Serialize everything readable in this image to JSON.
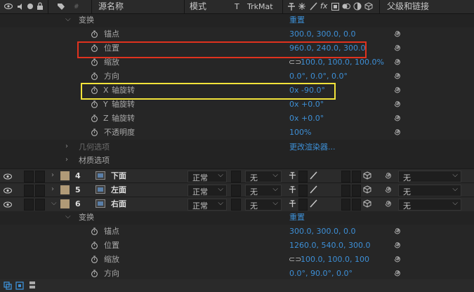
{
  "header": {
    "source_name": "源名称",
    "mode": "模式",
    "t": "T",
    "trkmat": "TrkMat",
    "parent": "父级和链接",
    "hash": "#"
  },
  "transform_group_1": {
    "label": "变换",
    "reset": "重置",
    "props": [
      {
        "name": "锚点",
        "value": "300.0, 300.0, 0.0",
        "axis": ""
      },
      {
        "name": "位置",
        "value": "960.0, 240.0, 300.0",
        "axis": ""
      },
      {
        "name": "缩放",
        "value": "100.0, 100.0, 100.0%",
        "axis": ""
      },
      {
        "name": "方向",
        "value": "0.0°, 0.0°, 0.0°",
        "axis": ""
      },
      {
        "name": "轴旋转",
        "value": "0x -90.0°",
        "axis": "X"
      },
      {
        "name": "轴旋转",
        "value": "0x +0.0°",
        "axis": "Y"
      },
      {
        "name": "轴旋转",
        "value": "0x +0.0°",
        "axis": "Z"
      },
      {
        "name": "不透明度",
        "value": "100%",
        "axis": ""
      }
    ]
  },
  "geometry": {
    "label": "几何选项",
    "value": "更改渲染器..."
  },
  "material": {
    "label": "材质选项"
  },
  "layers": [
    {
      "num": "4",
      "name": "下面",
      "mode": "正常",
      "trkmat": "无",
      "parent": "无"
    },
    {
      "num": "5",
      "name": "左面",
      "mode": "正常",
      "trkmat": "无",
      "parent": "无"
    },
    {
      "num": "6",
      "name": "右面",
      "mode": "正常",
      "trkmat": "无",
      "parent": "无"
    }
  ],
  "transform_group_2": {
    "label": "变换",
    "reset": "重置",
    "props": [
      {
        "name": "锚点",
        "value": "300.0, 300.0, 0.0"
      },
      {
        "name": "位置",
        "value": "1260.0, 540.0, 300.0"
      },
      {
        "name": "缩放",
        "value": "100.0, 100.0, 100"
      },
      {
        "name": "方向",
        "value": "0.0°, 90.0°, 0.0°"
      }
    ]
  },
  "colors": {
    "value_blue": "#3d8fd6",
    "highlight_red": "#e0321e",
    "highlight_yellow": "#f2e33a",
    "label_color": "#b09a77"
  }
}
